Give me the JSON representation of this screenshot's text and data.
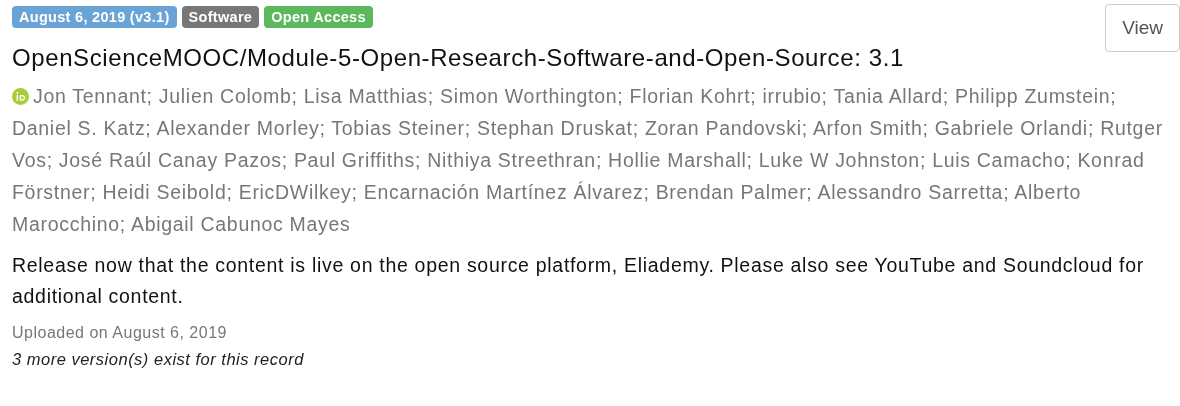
{
  "badges": [
    {
      "label": "August 6, 2019 (v3.1)",
      "color": "#6aa3d5"
    },
    {
      "label": "Software",
      "color": "#777777"
    },
    {
      "label": "Open Access",
      "color": "#5cb85c"
    }
  ],
  "view_button": "View",
  "title": "OpenScienceMOOC/Module-5-Open-Research-Software-and-Open-Source: 3.1",
  "authors": [
    "Jon Tennant; Julien Colomb; Lisa Matthias; Simon Worthington; Florian Kohrt; irrubio; Tania Allard; Philipp Zumstein;",
    "Daniel S. Katz; Alexander Morley; Tobias Steiner; Stephan Druskat; Zoran Pandovski; Arfon Smith; Gabriele Orlandi; Rutger Vos; José Raúl Canay Pazos; Paul Griffiths; Nithiya Streethran; Hollie Marshall; Luke W Johnston; Luis Camacho; Konrad Förstner; Heidi Seibold; EricDWilkey; Encarnación Martínez Álvarez; Brendan Palmer; Alessandro Sarretta; Alberto Marocchino; Abigail Cabunoc Mayes"
  ],
  "description": "Release now that the content is live on the open source platform, Eliademy. Please also see YouTube and Soundcloud for additional content.",
  "uploaded": "Uploaded on August 6, 2019",
  "versions_note": "3 more version(s) exist for this record"
}
